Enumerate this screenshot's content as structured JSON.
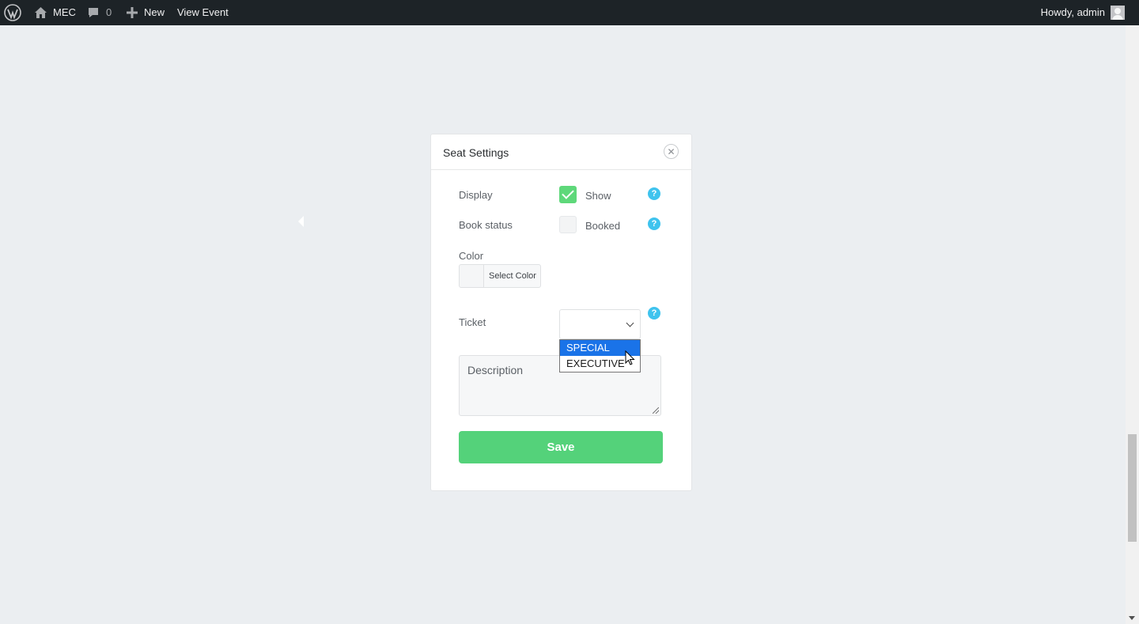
{
  "adminbar": {
    "site_name": "MEC",
    "comments_count": "0",
    "new_label": "New",
    "view_event_label": "View Event",
    "account_label": "Howdy, admin"
  },
  "modal": {
    "title": "Seat Settings",
    "close_symbol": "✕",
    "display": {
      "label": "Display",
      "checkbox_label": "Show",
      "checked": true
    },
    "book_status": {
      "label": "Book status",
      "checkbox_label": "Booked",
      "checked": false
    },
    "color": {
      "label": "Color",
      "button_label": "Select Color"
    },
    "ticket": {
      "label": "Ticket",
      "selected_value": ""
    },
    "description": {
      "placeholder": "Description"
    },
    "save_label": "Save",
    "help_symbol": "?"
  },
  "dropdown": {
    "options": [
      {
        "label": "SPECIAL",
        "highlighted": true
      },
      {
        "label": "EXECUTIVE",
        "highlighted": false
      }
    ]
  },
  "colors": {
    "accent_green": "#54d27a",
    "help_blue": "#3fc3ee",
    "adminbar_bg": "#1d2327",
    "page_bg": "#ebeef1"
  },
  "icons": {
    "wp_logo": "wordpress-logo-icon",
    "home": "home-icon",
    "comments": "comment-bubble-icon",
    "plus": "plus-icon",
    "avatar": "user-avatar-icon",
    "close": "close-icon",
    "help": "help-icon",
    "chevron": "chevron-down-icon"
  }
}
